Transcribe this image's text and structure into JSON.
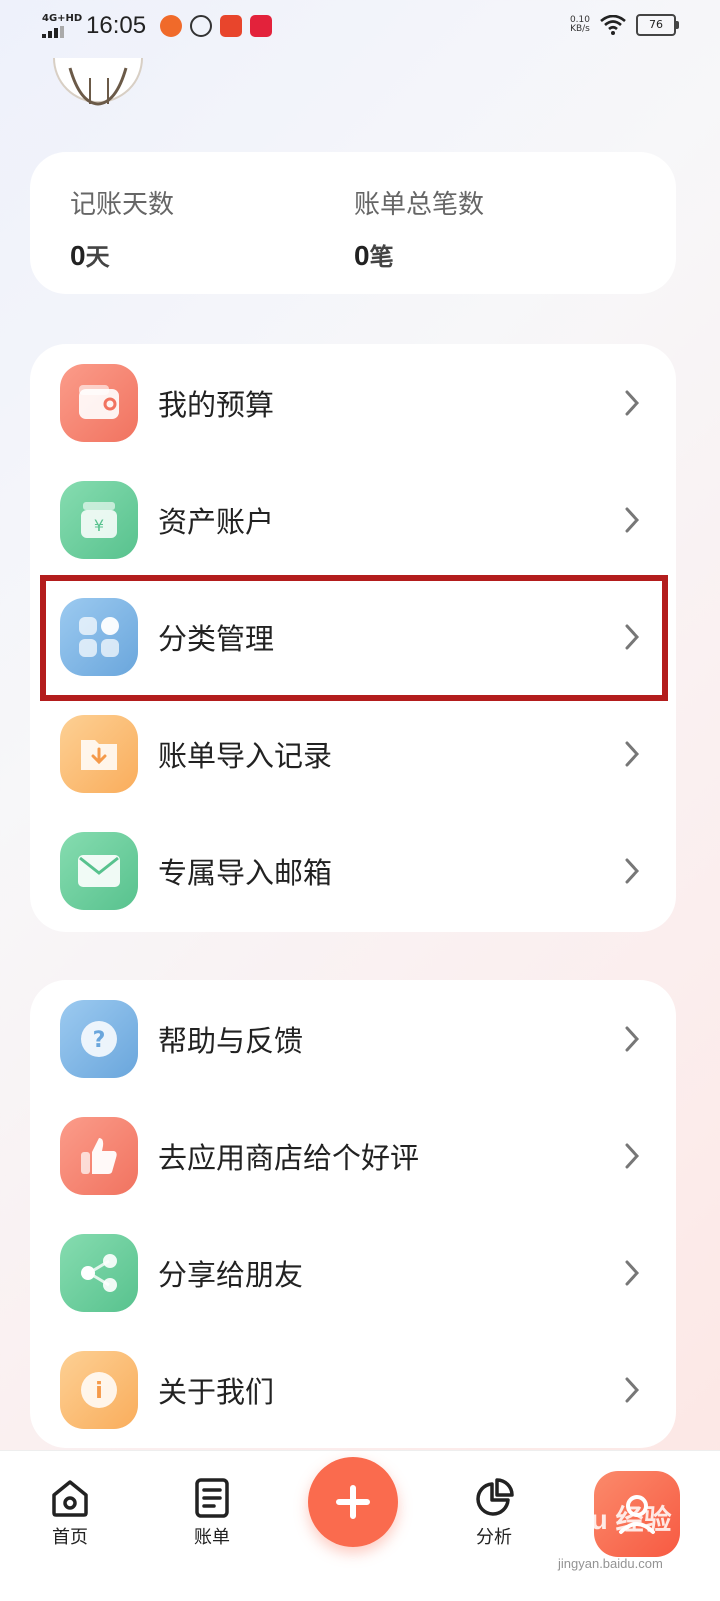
{
  "status_bar": {
    "network": "4G+HD",
    "time": "16:05",
    "speed_value": "0.10",
    "speed_unit": "KB/s",
    "battery": "76"
  },
  "stats": {
    "days_label": "记账天数",
    "days_value": "0",
    "days_unit": "天",
    "bills_label": "账单总笔数",
    "bills_value": "0",
    "bills_unit": "笔"
  },
  "menu_group_1": [
    {
      "label": "我的预算",
      "icon": "wallet-icon",
      "color": "#f68a78"
    },
    {
      "label": "资产账户",
      "icon": "money-bag-icon",
      "color": "#6fcf9e"
    },
    {
      "label": "分类管理",
      "icon": "category-grid-icon",
      "color": "#7fb7e6"
    },
    {
      "label": "账单导入记录",
      "icon": "folder-import-icon",
      "color": "#fcc076"
    },
    {
      "label": "专属导入邮箱",
      "icon": "mail-icon",
      "color": "#6fcf9e"
    }
  ],
  "menu_group_2": [
    {
      "label": "帮助与反馈",
      "icon": "help-icon",
      "color": "#7fb7e6"
    },
    {
      "label": "去应用商店给个好评",
      "icon": "thumbs-up-icon",
      "color": "#f68a78"
    },
    {
      "label": "分享给朋友",
      "icon": "share-icon",
      "color": "#6fcf9e"
    },
    {
      "label": "关于我们",
      "icon": "info-icon",
      "color": "#fcc076"
    }
  ],
  "bottom_nav": {
    "home": "首页",
    "bills": "账单",
    "analysis": "分析"
  },
  "watermark": {
    "text": "Baidu 经验",
    "sub": "jingyan.baidu.com"
  },
  "colors": {
    "accent": "#fa6b4e",
    "highlight_border": "#b31d1d"
  }
}
